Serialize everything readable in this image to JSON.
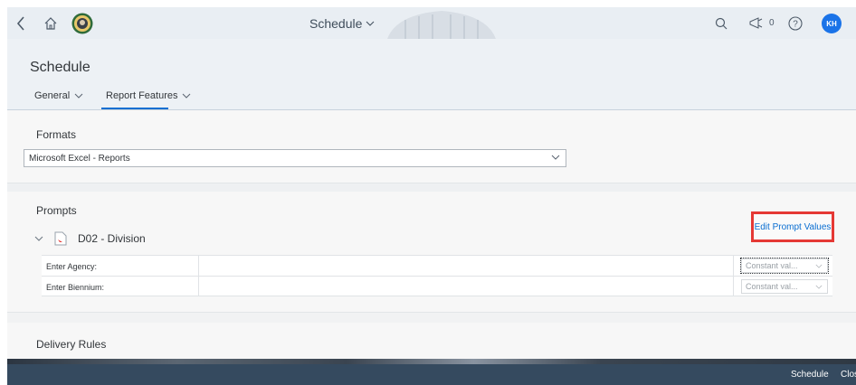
{
  "shellbar": {
    "app_title": "Schedule",
    "notification_count": "0",
    "avatar_initials": "KH"
  },
  "page": {
    "title": "Schedule"
  },
  "tabs": [
    {
      "label": "General"
    },
    {
      "label": "Report Features"
    }
  ],
  "formats": {
    "title": "Formats",
    "selected": "Microsoft Excel - Reports"
  },
  "prompts": {
    "title": "Prompts",
    "group_name": "D02 - Division",
    "edit_link": "Edit Prompt Values",
    "rows": [
      {
        "label": "Enter Agency:",
        "value": "",
        "type_select": "Constant val..."
      },
      {
        "label": "Enter Biennium:",
        "value": "",
        "type_select": "Constant val..."
      }
    ]
  },
  "delivery": {
    "title": "Delivery Rules"
  },
  "footer": {
    "schedule_label": "Schedule",
    "close_label": "Clos"
  },
  "colors": {
    "accent": "#0a6ed1",
    "highlight_box": "#e53935",
    "footer_bg": "#354a5f",
    "avatar_bg": "#1a73e8"
  }
}
